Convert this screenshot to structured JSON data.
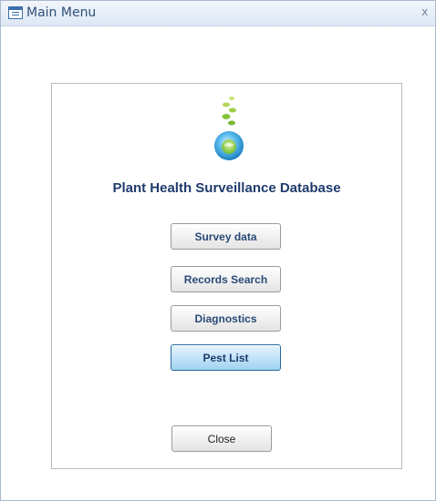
{
  "window": {
    "title": "Main Menu",
    "close_glyph": "x"
  },
  "form": {
    "app_title": "Plant Health Surveillance Database",
    "logo_icon": "plant-sprout-logo-icon",
    "buttons": [
      {
        "label": "Survey data"
      },
      {
        "label": "Records Search"
      },
      {
        "label": "Diagnostics"
      },
      {
        "label": "Pest List",
        "state": "highlighted"
      }
    ],
    "close_label": "Close"
  },
  "colors": {
    "title_text": "#1f3b6e",
    "button_text": "#2a4a76",
    "highlight_top": "#e6f4fc",
    "highlight_bottom": "#9fd3f2"
  }
}
